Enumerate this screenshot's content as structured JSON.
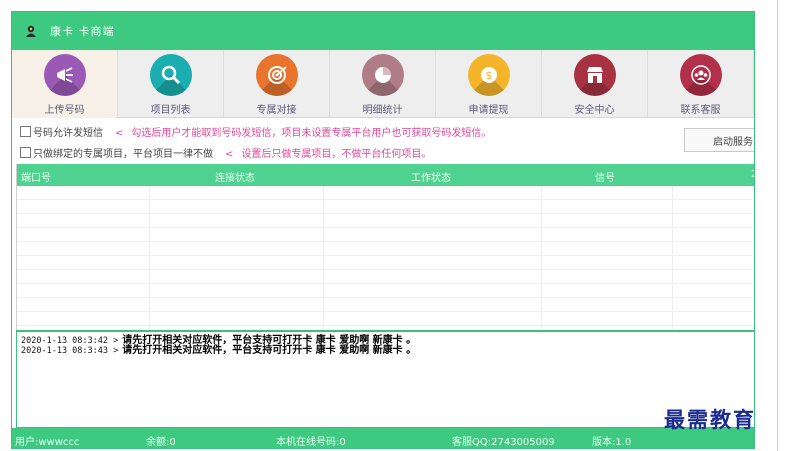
{
  "window": {
    "title": "康卡 卡商端"
  },
  "toolbar": {
    "items": [
      {
        "label": "上传号码",
        "icon": "megaphone-icon",
        "color": "#9b59b6"
      },
      {
        "label": "项目列表",
        "icon": "search-icon",
        "color": "#1aaeb0"
      },
      {
        "label": "专属对接",
        "icon": "target-icon",
        "color": "#e8742e"
      },
      {
        "label": "明细统计",
        "icon": "pie-chart-icon",
        "color": "#b07d87"
      },
      {
        "label": "申请提现",
        "icon": "coin-icon",
        "color": "#f5b52b"
      },
      {
        "label": "安全中心",
        "icon": "shop-icon",
        "color": "#a83241"
      },
      {
        "label": "联系客服",
        "icon": "people-icon",
        "color": "#b3304a"
      }
    ]
  },
  "options": {
    "sms_checkbox_label": "号码允许发短信",
    "sms_note": "勾选后用户才能取到号码发短信，项目未设置专属平台用户也可获取号码发短信。",
    "exclusive_checkbox_label": "只做绑定的专属项目，平台项目一律不做",
    "exclusive_note": "设置后只做专属项目，不做平台任何项目。",
    "note_arrow": "<",
    "start_button": "启动服务"
  },
  "grid": {
    "columns": [
      "端口号",
      "连接状态",
      "工作状态",
      "信号",
      "2"
    ]
  },
  "log": {
    "lines": [
      {
        "time": "2020-1-13 08:3:42 >",
        "message": "请先打开相关对应软件，平台支持可打开卡 康卡 爱助啊 新康卡 。"
      },
      {
        "time": "2020-1-13 08:3:43 >",
        "message": "请先打开相关对应软件，平台支持可打开卡 康卡 爱助啊 新康卡 。"
      }
    ]
  },
  "status": {
    "user": "用户:wwwccc",
    "balance": "余额:0",
    "online": "本机在线号码:0",
    "qq": "客服QQ:2743005009",
    "version": "版本:1.0"
  },
  "watermark": "最需教育"
}
